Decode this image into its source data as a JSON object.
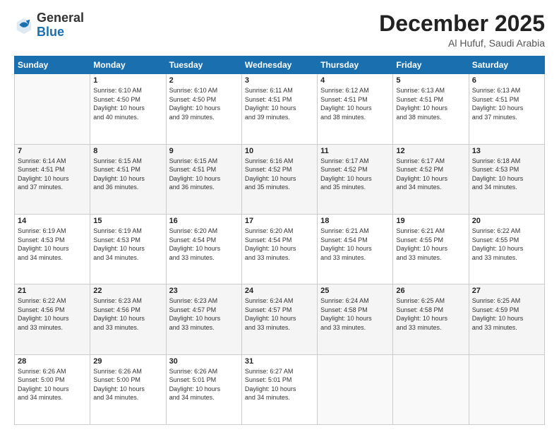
{
  "header": {
    "logo_general": "General",
    "logo_blue": "Blue",
    "month_title": "December 2025",
    "location": "Al Hufuf, Saudi Arabia"
  },
  "days_of_week": [
    "Sunday",
    "Monday",
    "Tuesday",
    "Wednesday",
    "Thursday",
    "Friday",
    "Saturday"
  ],
  "weeks": [
    [
      {
        "day": "",
        "info": ""
      },
      {
        "day": "1",
        "info": "Sunrise: 6:10 AM\nSunset: 4:50 PM\nDaylight: 10 hours\nand 40 minutes."
      },
      {
        "day": "2",
        "info": "Sunrise: 6:10 AM\nSunset: 4:50 PM\nDaylight: 10 hours\nand 39 minutes."
      },
      {
        "day": "3",
        "info": "Sunrise: 6:11 AM\nSunset: 4:51 PM\nDaylight: 10 hours\nand 39 minutes."
      },
      {
        "day": "4",
        "info": "Sunrise: 6:12 AM\nSunset: 4:51 PM\nDaylight: 10 hours\nand 38 minutes."
      },
      {
        "day": "5",
        "info": "Sunrise: 6:13 AM\nSunset: 4:51 PM\nDaylight: 10 hours\nand 38 minutes."
      },
      {
        "day": "6",
        "info": "Sunrise: 6:13 AM\nSunset: 4:51 PM\nDaylight: 10 hours\nand 37 minutes."
      }
    ],
    [
      {
        "day": "7",
        "info": "Sunrise: 6:14 AM\nSunset: 4:51 PM\nDaylight: 10 hours\nand 37 minutes."
      },
      {
        "day": "8",
        "info": "Sunrise: 6:15 AM\nSunset: 4:51 PM\nDaylight: 10 hours\nand 36 minutes."
      },
      {
        "day": "9",
        "info": "Sunrise: 6:15 AM\nSunset: 4:51 PM\nDaylight: 10 hours\nand 36 minutes."
      },
      {
        "day": "10",
        "info": "Sunrise: 6:16 AM\nSunset: 4:52 PM\nDaylight: 10 hours\nand 35 minutes."
      },
      {
        "day": "11",
        "info": "Sunrise: 6:17 AM\nSunset: 4:52 PM\nDaylight: 10 hours\nand 35 minutes."
      },
      {
        "day": "12",
        "info": "Sunrise: 6:17 AM\nSunset: 4:52 PM\nDaylight: 10 hours\nand 34 minutes."
      },
      {
        "day": "13",
        "info": "Sunrise: 6:18 AM\nSunset: 4:53 PM\nDaylight: 10 hours\nand 34 minutes."
      }
    ],
    [
      {
        "day": "14",
        "info": "Sunrise: 6:19 AM\nSunset: 4:53 PM\nDaylight: 10 hours\nand 34 minutes."
      },
      {
        "day": "15",
        "info": "Sunrise: 6:19 AM\nSunset: 4:53 PM\nDaylight: 10 hours\nand 34 minutes."
      },
      {
        "day": "16",
        "info": "Sunrise: 6:20 AM\nSunset: 4:54 PM\nDaylight: 10 hours\nand 33 minutes."
      },
      {
        "day": "17",
        "info": "Sunrise: 6:20 AM\nSunset: 4:54 PM\nDaylight: 10 hours\nand 33 minutes."
      },
      {
        "day": "18",
        "info": "Sunrise: 6:21 AM\nSunset: 4:54 PM\nDaylight: 10 hours\nand 33 minutes."
      },
      {
        "day": "19",
        "info": "Sunrise: 6:21 AM\nSunset: 4:55 PM\nDaylight: 10 hours\nand 33 minutes."
      },
      {
        "day": "20",
        "info": "Sunrise: 6:22 AM\nSunset: 4:55 PM\nDaylight: 10 hours\nand 33 minutes."
      }
    ],
    [
      {
        "day": "21",
        "info": "Sunrise: 6:22 AM\nSunset: 4:56 PM\nDaylight: 10 hours\nand 33 minutes."
      },
      {
        "day": "22",
        "info": "Sunrise: 6:23 AM\nSunset: 4:56 PM\nDaylight: 10 hours\nand 33 minutes."
      },
      {
        "day": "23",
        "info": "Sunrise: 6:23 AM\nSunset: 4:57 PM\nDaylight: 10 hours\nand 33 minutes."
      },
      {
        "day": "24",
        "info": "Sunrise: 6:24 AM\nSunset: 4:57 PM\nDaylight: 10 hours\nand 33 minutes."
      },
      {
        "day": "25",
        "info": "Sunrise: 6:24 AM\nSunset: 4:58 PM\nDaylight: 10 hours\nand 33 minutes."
      },
      {
        "day": "26",
        "info": "Sunrise: 6:25 AM\nSunset: 4:58 PM\nDaylight: 10 hours\nand 33 minutes."
      },
      {
        "day": "27",
        "info": "Sunrise: 6:25 AM\nSunset: 4:59 PM\nDaylight: 10 hours\nand 33 minutes."
      }
    ],
    [
      {
        "day": "28",
        "info": "Sunrise: 6:26 AM\nSunset: 5:00 PM\nDaylight: 10 hours\nand 34 minutes."
      },
      {
        "day": "29",
        "info": "Sunrise: 6:26 AM\nSunset: 5:00 PM\nDaylight: 10 hours\nand 34 minutes."
      },
      {
        "day": "30",
        "info": "Sunrise: 6:26 AM\nSunset: 5:01 PM\nDaylight: 10 hours\nand 34 minutes."
      },
      {
        "day": "31",
        "info": "Sunrise: 6:27 AM\nSunset: 5:01 PM\nDaylight: 10 hours\nand 34 minutes."
      },
      {
        "day": "",
        "info": ""
      },
      {
        "day": "",
        "info": ""
      },
      {
        "day": "",
        "info": ""
      }
    ]
  ]
}
